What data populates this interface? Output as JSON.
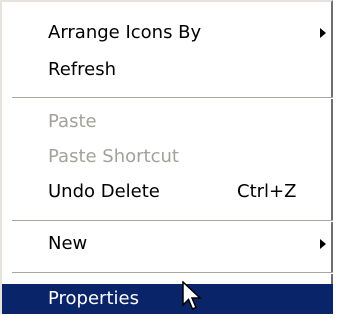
{
  "menu": {
    "items": [
      {
        "label": "Arrange Icons By",
        "has_submenu": true
      },
      {
        "label": "Refresh"
      },
      {
        "label": "Paste",
        "disabled": true
      },
      {
        "label": "Paste Shortcut",
        "disabled": true
      },
      {
        "label": "Undo Delete",
        "shortcut": "Ctrl+Z"
      },
      {
        "label": "New",
        "has_submenu": true
      },
      {
        "label": "Properties",
        "selected": true
      }
    ]
  },
  "colors": {
    "selection": "#0a246a",
    "disabled_text": "#a4a19a"
  },
  "icons": {
    "submenu_arrow": "chevron-right-icon",
    "pointer": "mouse-cursor-icon"
  }
}
